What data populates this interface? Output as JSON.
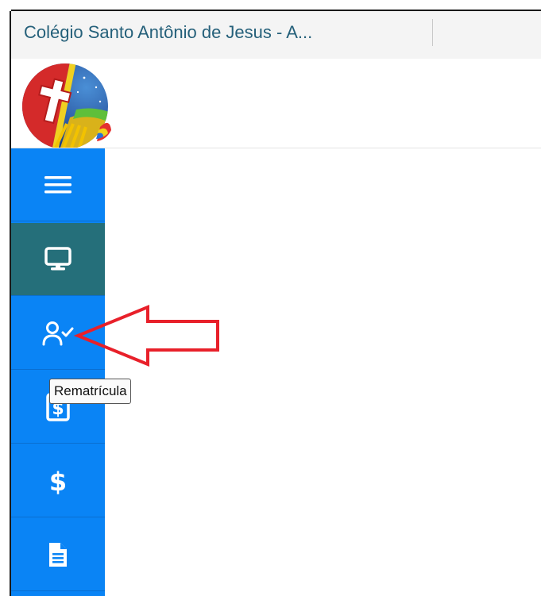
{
  "browser": {
    "tab_title": "Colégio Santo Antônio de Jesus - A..."
  },
  "header": {
    "logo_icon": "school-crest-logo"
  },
  "sidebar": {
    "items": [
      {
        "icon": "hamburger-menu-icon",
        "active": false
      },
      {
        "icon": "monitor-icon",
        "active": true
      },
      {
        "icon": "user-check-icon",
        "active": false
      },
      {
        "icon": "invoice-dollar-icon",
        "active": false
      },
      {
        "icon": "dollar-icon",
        "active": false
      },
      {
        "icon": "document-icon",
        "active": false
      }
    ]
  },
  "tooltip": {
    "text": "Rematrícula"
  },
  "annotation": {
    "arrow_color": "#e8202a"
  },
  "colors": {
    "sidebar": "#0a84f5",
    "sidebar_active": "#256f7a",
    "tab_title": "#25607a"
  }
}
